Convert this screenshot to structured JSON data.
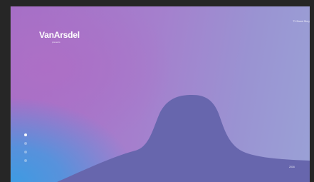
{
  "brand": {
    "name": "VanArsdel",
    "tagline": "presents"
  },
  "header": {
    "link_label": "TV Brand Story"
  },
  "pager": {
    "dots": [
      "slide-1",
      "slide-2",
      "slide-3",
      "slide-4"
    ],
    "active_index": 0
  },
  "footer": {
    "label": "2016"
  },
  "colors": {
    "hill": "#6766ad",
    "frame": "#262626",
    "accent_blue": "#3e9be2",
    "accent_purple": "#a46ec6"
  }
}
